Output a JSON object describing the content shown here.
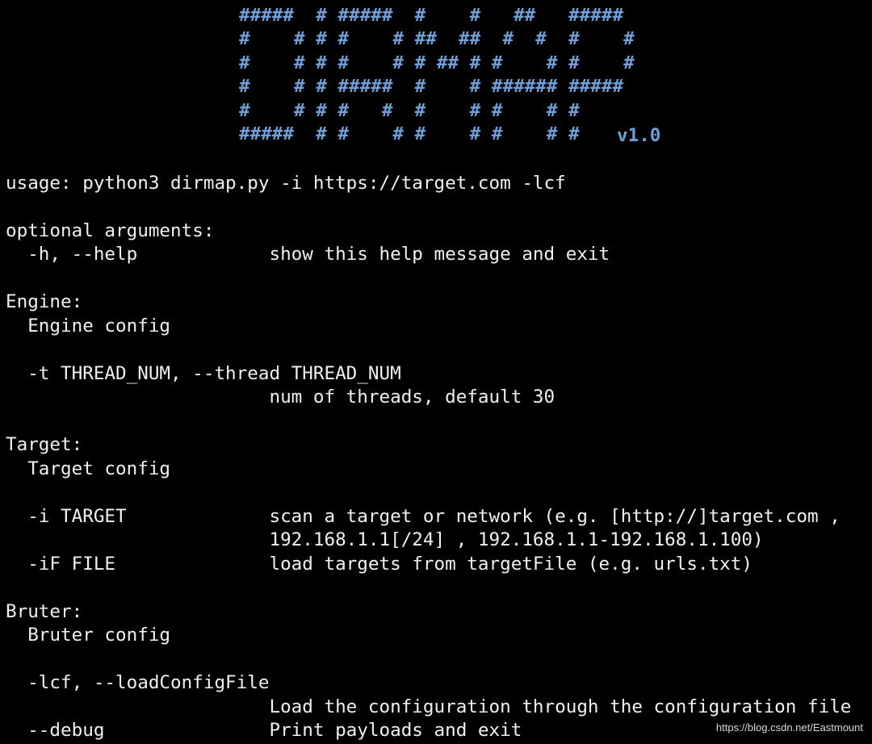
{
  "banner": {
    "lines": [
      "#####  # #####  #    #   ##   #####",
      "#    # # #    # ##  ##  #  #  #    #",
      "#    # # #    # # ## # #    # #    #",
      "#    # # #####  #    # ###### #####",
      "#    # # #   #  #    # #    # #",
      "#####  # #    # #    # #    # #"
    ],
    "version": "v1.0",
    "color": "#6f9fd8"
  },
  "help": {
    "usage": "usage: python3 dirmap.py -i https://target.com -lcf",
    "optional_header": "optional arguments:",
    "help_opt": "  -h, --help            show this help message and exit",
    "engine_header": "Engine:",
    "engine_desc": "  Engine config",
    "thread_opt": "  -t THREAD_NUM, --thread THREAD_NUM",
    "thread_desc": "                        num of threads, default 30",
    "target_header": "Target:",
    "target_desc": "  Target config",
    "target_opt": "  -i TARGET             scan a target or network (e.g. [http://]target.com ,",
    "target_opt_cont": "                        192.168.1.1[/24] , 192.168.1.1-192.168.1.100)",
    "file_opt": "  -iF FILE              load targets from targetFile (e.g. urls.txt)",
    "bruter_header": "Bruter:",
    "bruter_desc": "  Bruter config",
    "lcf_opt": "  -lcf, --loadConfigFile",
    "lcf_desc": "                        Load the configuration through the configuration file",
    "debug_opt": "  --debug               Print payloads and exit"
  },
  "watermark": "https://blog.csdn.net/Eastmount",
  "colors": {
    "background": "#000000",
    "text": "#f0f0f0",
    "banner": "#6f9fd8"
  }
}
